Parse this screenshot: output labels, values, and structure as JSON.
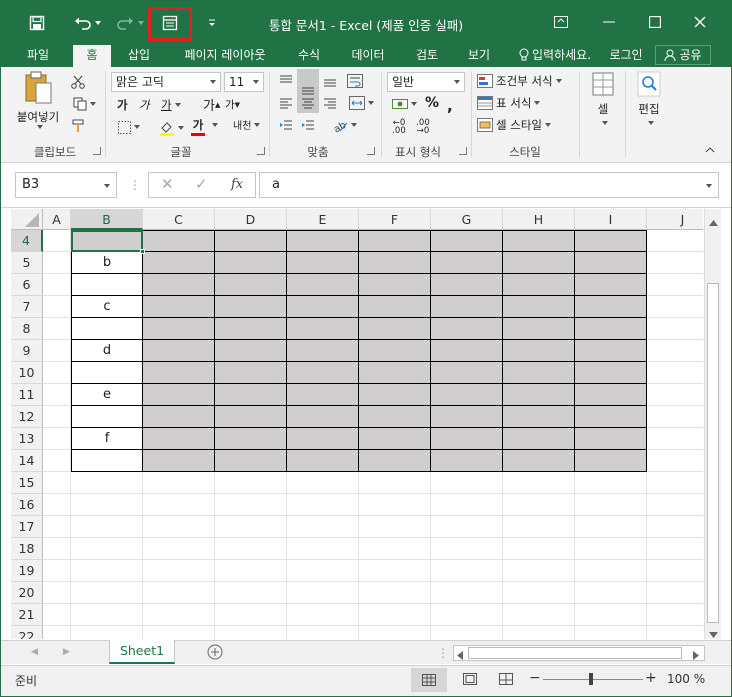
{
  "window": {
    "title": "통합 문서1 - Excel (제품 인증 실패)"
  },
  "tabs": [
    {
      "label": "파일"
    },
    {
      "label": "홈"
    },
    {
      "label": "삽입"
    },
    {
      "label": "페이지 레이아웃"
    },
    {
      "label": "수식"
    },
    {
      "label": "데이터"
    },
    {
      "label": "검토"
    },
    {
      "label": "보기"
    }
  ],
  "tellme": "입력하세요.",
  "login": "로그인",
  "share": "공유",
  "ribbon": {
    "clipboard": {
      "paste": "붙여넣기",
      "label": "클립보드"
    },
    "font": {
      "name": "맑은 고딕",
      "size": "11",
      "label": "글꼴",
      "increase": "가",
      "decrease": "가",
      "bold": "가",
      "italic": "가",
      "underline": "가",
      "fontcolor": "가",
      "phonetic": "내천"
    },
    "alignment": {
      "label": "맞춤"
    },
    "number": {
      "format": "일반",
      "percent": "%",
      "label": "표시 형식"
    },
    "styles": {
      "conditional": "조건부 서식",
      "table": "표 서식",
      "cell": "셀 스타일",
      "label": "스타일"
    },
    "cells": {
      "label": "셀"
    },
    "editing": {
      "label": "편집"
    }
  },
  "formula": {
    "namebox": "B3",
    "fx": "fx",
    "value": "a"
  },
  "columns": [
    "A",
    "B",
    "C",
    "D",
    "E",
    "F",
    "G",
    "H",
    "I",
    "J"
  ],
  "rows": [
    "4",
    "5",
    "6",
    "7",
    "8",
    "9",
    "10",
    "11",
    "12",
    "13",
    "14",
    "15",
    "16",
    "17",
    "18",
    "19",
    "20",
    "21",
    "22"
  ],
  "cells": {
    "B5": "b",
    "B7": "c",
    "B9": "d",
    "B11": "e",
    "B13": "f"
  },
  "sheet": {
    "name": "Sheet1"
  },
  "status": {
    "ready": "준비",
    "zoom": "100 %",
    "minus": "−",
    "plus": "+"
  }
}
